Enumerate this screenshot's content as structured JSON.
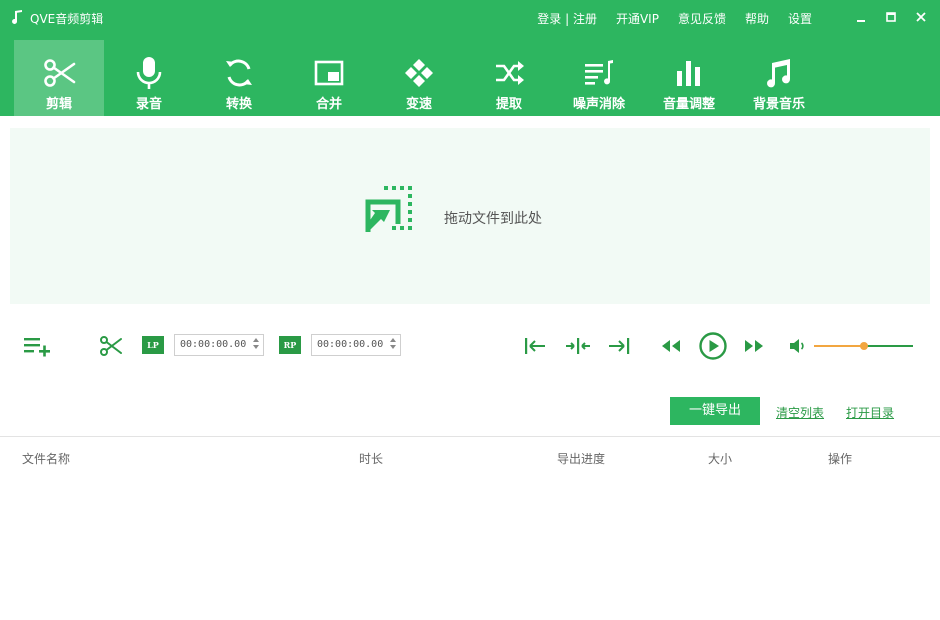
{
  "app": {
    "title": "QVE音频剪辑"
  },
  "top_links": {
    "login": "登录 | 注册",
    "vip": "开通VIP",
    "feedback": "意见反馈",
    "help": "帮助",
    "settings": "设置"
  },
  "toolbar": {
    "items": [
      {
        "label": "剪辑",
        "icon": "scissors-icon"
      },
      {
        "label": "录音",
        "icon": "microphone-icon"
      },
      {
        "label": "转换",
        "icon": "convert-icon"
      },
      {
        "label": "合并",
        "icon": "merge-icon"
      },
      {
        "label": "变速",
        "icon": "speed-icon"
      },
      {
        "label": "提取",
        "icon": "extract-icon"
      },
      {
        "label": "噪声消除",
        "icon": "noise-icon"
      },
      {
        "label": "音量调整",
        "icon": "volume-bars-icon"
      },
      {
        "label": "背景音乐",
        "icon": "music-note-icon"
      }
    ]
  },
  "drop_zone": {
    "text": "拖动文件到此处"
  },
  "controls": {
    "lp_tag": "LP",
    "rp_tag": "RP",
    "start_time": "00:00:00.00",
    "end_time": "00:00:00.00",
    "volume": 0.5
  },
  "actions": {
    "export": "一键导出",
    "clear_list": "清空列表",
    "open_dir": "打开目录"
  },
  "table": {
    "columns": [
      "文件名称",
      "时长",
      "导出进度",
      "大小",
      "操作"
    ]
  },
  "colors": {
    "brand": "#2db660",
    "accent": "#2a9a45",
    "volume_fill": "#f2a640"
  }
}
